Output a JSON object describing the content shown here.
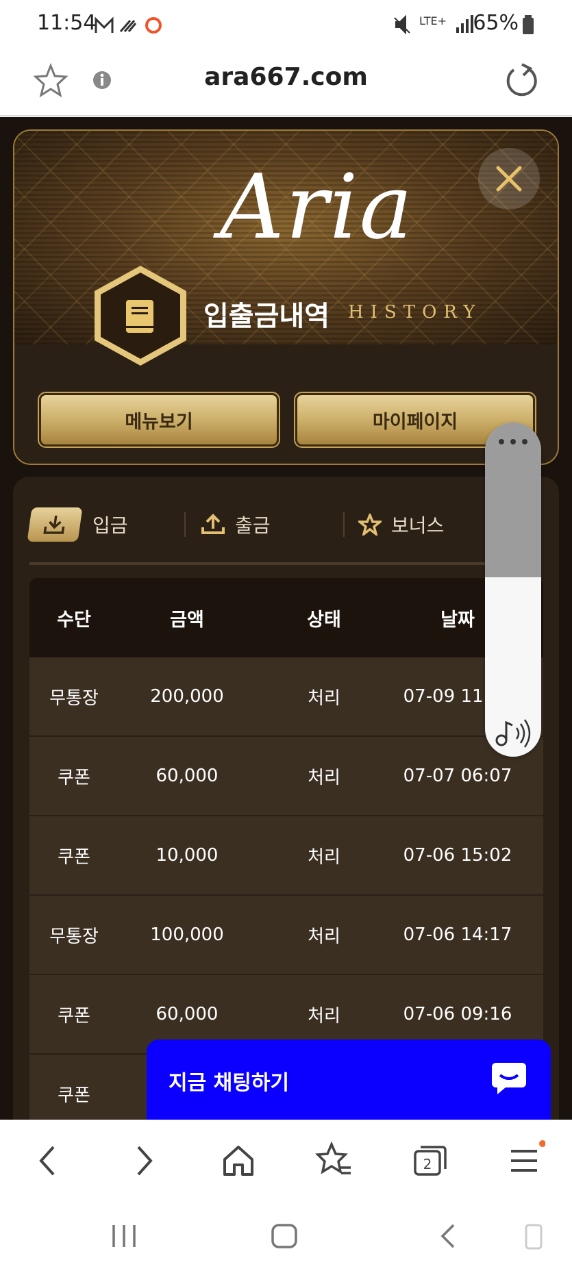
{
  "status_bar": {
    "time": "11:54",
    "network": "LTE+",
    "battery": "65%"
  },
  "browser": {
    "url": "ara667.com",
    "tab_count": "2"
  },
  "site": {
    "logo": "Aria",
    "page_title": "입출금내역",
    "page_subtitle": "HISTORY",
    "menu_button": "메뉴보기",
    "mypage_button": "마이페이지",
    "tabs": [
      {
        "label": "입금",
        "active": true
      },
      {
        "label": "출금",
        "active": false
      },
      {
        "label": "보너스",
        "active": false
      }
    ],
    "table": {
      "headers": [
        "수단",
        "금액",
        "상태",
        "날짜"
      ],
      "rows": [
        [
          "무통장",
          "200,000",
          "처리",
          "07-09 11:28"
        ],
        [
          "쿠폰",
          "60,000",
          "처리",
          "07-07 06:07"
        ],
        [
          "쿠폰",
          "10,000",
          "처리",
          "07-06 15:02"
        ],
        [
          "무통장",
          "100,000",
          "처리",
          "07-06 14:17"
        ],
        [
          "쿠폰",
          "60,000",
          "처리",
          "07-06 09:16"
        ],
        [
          "쿠폰",
          "",
          "",
          ""
        ]
      ]
    },
    "chat_button": "지금 채팅하기"
  },
  "colors": {
    "gold": "#cdb06a",
    "chat_blue": "#0b00ff",
    "panel_brown": "#2a2016"
  }
}
